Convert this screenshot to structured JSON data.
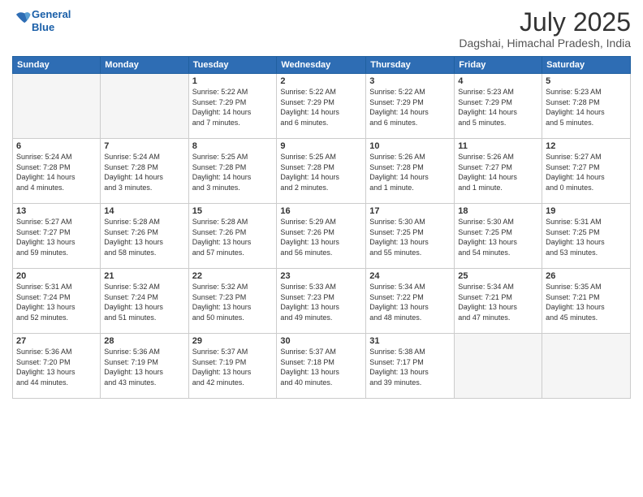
{
  "logo": {
    "line1": "General",
    "line2": "Blue"
  },
  "title": "July 2025",
  "subtitle": "Dagshai, Himachal Pradesh, India",
  "weekdays": [
    "Sunday",
    "Monday",
    "Tuesday",
    "Wednesday",
    "Thursday",
    "Friday",
    "Saturday"
  ],
  "weeks": [
    [
      {
        "day": "",
        "info": ""
      },
      {
        "day": "",
        "info": ""
      },
      {
        "day": "1",
        "info": "Sunrise: 5:22 AM\nSunset: 7:29 PM\nDaylight: 14 hours\nand 7 minutes."
      },
      {
        "day": "2",
        "info": "Sunrise: 5:22 AM\nSunset: 7:29 PM\nDaylight: 14 hours\nand 6 minutes."
      },
      {
        "day": "3",
        "info": "Sunrise: 5:22 AM\nSunset: 7:29 PM\nDaylight: 14 hours\nand 6 minutes."
      },
      {
        "day": "4",
        "info": "Sunrise: 5:23 AM\nSunset: 7:29 PM\nDaylight: 14 hours\nand 5 minutes."
      },
      {
        "day": "5",
        "info": "Sunrise: 5:23 AM\nSunset: 7:28 PM\nDaylight: 14 hours\nand 5 minutes."
      }
    ],
    [
      {
        "day": "6",
        "info": "Sunrise: 5:24 AM\nSunset: 7:28 PM\nDaylight: 14 hours\nand 4 minutes."
      },
      {
        "day": "7",
        "info": "Sunrise: 5:24 AM\nSunset: 7:28 PM\nDaylight: 14 hours\nand 3 minutes."
      },
      {
        "day": "8",
        "info": "Sunrise: 5:25 AM\nSunset: 7:28 PM\nDaylight: 14 hours\nand 3 minutes."
      },
      {
        "day": "9",
        "info": "Sunrise: 5:25 AM\nSunset: 7:28 PM\nDaylight: 14 hours\nand 2 minutes."
      },
      {
        "day": "10",
        "info": "Sunrise: 5:26 AM\nSunset: 7:28 PM\nDaylight: 14 hours\nand 1 minute."
      },
      {
        "day": "11",
        "info": "Sunrise: 5:26 AM\nSunset: 7:27 PM\nDaylight: 14 hours\nand 1 minute."
      },
      {
        "day": "12",
        "info": "Sunrise: 5:27 AM\nSunset: 7:27 PM\nDaylight: 14 hours\nand 0 minutes."
      }
    ],
    [
      {
        "day": "13",
        "info": "Sunrise: 5:27 AM\nSunset: 7:27 PM\nDaylight: 13 hours\nand 59 minutes."
      },
      {
        "day": "14",
        "info": "Sunrise: 5:28 AM\nSunset: 7:26 PM\nDaylight: 13 hours\nand 58 minutes."
      },
      {
        "day": "15",
        "info": "Sunrise: 5:28 AM\nSunset: 7:26 PM\nDaylight: 13 hours\nand 57 minutes."
      },
      {
        "day": "16",
        "info": "Sunrise: 5:29 AM\nSunset: 7:26 PM\nDaylight: 13 hours\nand 56 minutes."
      },
      {
        "day": "17",
        "info": "Sunrise: 5:30 AM\nSunset: 7:25 PM\nDaylight: 13 hours\nand 55 minutes."
      },
      {
        "day": "18",
        "info": "Sunrise: 5:30 AM\nSunset: 7:25 PM\nDaylight: 13 hours\nand 54 minutes."
      },
      {
        "day": "19",
        "info": "Sunrise: 5:31 AM\nSunset: 7:25 PM\nDaylight: 13 hours\nand 53 minutes."
      }
    ],
    [
      {
        "day": "20",
        "info": "Sunrise: 5:31 AM\nSunset: 7:24 PM\nDaylight: 13 hours\nand 52 minutes."
      },
      {
        "day": "21",
        "info": "Sunrise: 5:32 AM\nSunset: 7:24 PM\nDaylight: 13 hours\nand 51 minutes."
      },
      {
        "day": "22",
        "info": "Sunrise: 5:32 AM\nSunset: 7:23 PM\nDaylight: 13 hours\nand 50 minutes."
      },
      {
        "day": "23",
        "info": "Sunrise: 5:33 AM\nSunset: 7:23 PM\nDaylight: 13 hours\nand 49 minutes."
      },
      {
        "day": "24",
        "info": "Sunrise: 5:34 AM\nSunset: 7:22 PM\nDaylight: 13 hours\nand 48 minutes."
      },
      {
        "day": "25",
        "info": "Sunrise: 5:34 AM\nSunset: 7:21 PM\nDaylight: 13 hours\nand 47 minutes."
      },
      {
        "day": "26",
        "info": "Sunrise: 5:35 AM\nSunset: 7:21 PM\nDaylight: 13 hours\nand 45 minutes."
      }
    ],
    [
      {
        "day": "27",
        "info": "Sunrise: 5:36 AM\nSunset: 7:20 PM\nDaylight: 13 hours\nand 44 minutes."
      },
      {
        "day": "28",
        "info": "Sunrise: 5:36 AM\nSunset: 7:19 PM\nDaylight: 13 hours\nand 43 minutes."
      },
      {
        "day": "29",
        "info": "Sunrise: 5:37 AM\nSunset: 7:19 PM\nDaylight: 13 hours\nand 42 minutes."
      },
      {
        "day": "30",
        "info": "Sunrise: 5:37 AM\nSunset: 7:18 PM\nDaylight: 13 hours\nand 40 minutes."
      },
      {
        "day": "31",
        "info": "Sunrise: 5:38 AM\nSunset: 7:17 PM\nDaylight: 13 hours\nand 39 minutes."
      },
      {
        "day": "",
        "info": ""
      },
      {
        "day": "",
        "info": ""
      }
    ]
  ]
}
